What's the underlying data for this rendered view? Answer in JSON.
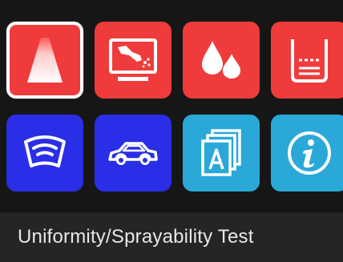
{
  "tiles": [
    {
      "icon": "spray-cone-icon",
      "color": "#ef3b3b",
      "selected": true
    },
    {
      "icon": "spray-monitor-icon",
      "color": "#ef3b3b",
      "selected": false
    },
    {
      "icon": "droplets-icon",
      "color": "#ef3b3b",
      "selected": false
    },
    {
      "icon": "beaker-icon",
      "color": "#ef3b3b",
      "selected": false
    },
    {
      "icon": "windshield-wiper-icon",
      "color": "#2a2ee6",
      "selected": false
    },
    {
      "icon": "car-icon",
      "color": "#2a2ee6",
      "selected": false
    },
    {
      "icon": "document-stack-a-icon",
      "color": "#2aa8d8",
      "selected": false
    },
    {
      "icon": "info-icon",
      "color": "#2aa8d8",
      "selected": false
    }
  ],
  "title_bar": {
    "label": "Uniformity/Sprayability Test"
  }
}
